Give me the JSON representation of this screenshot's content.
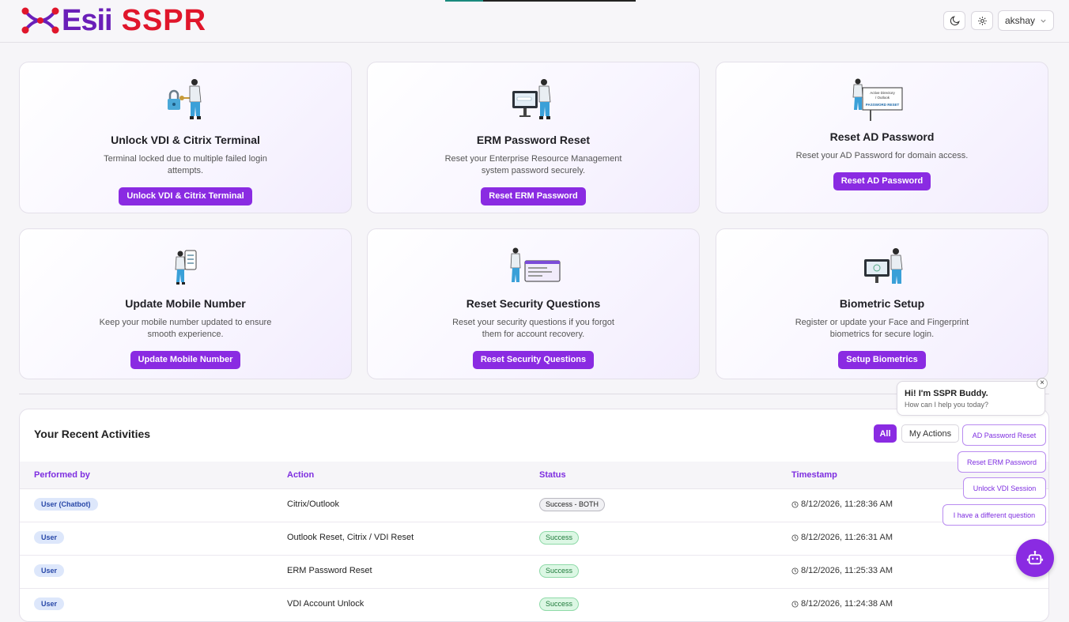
{
  "header": {
    "logo_brand": "Esii",
    "logo_product": "SSPR",
    "theme_icon": "moon-icon",
    "settings_icon": "gear-icon",
    "user_name": "akshay",
    "user_chevron_icon": "chevron-down-icon"
  },
  "cards": [
    {
      "title": "Unlock VDI & Citrix Terminal",
      "description": "Terminal locked due to multiple failed login attempts.",
      "button": "Unlock VDI & Citrix Terminal",
      "icon": "unlock-illustration"
    },
    {
      "title": "ERM Password Reset",
      "description": "Reset your Enterprise Resource Management system password securely.",
      "button": "Reset ERM Password",
      "icon": "monitor-illustration"
    },
    {
      "title": "Reset AD Password",
      "description": "Reset your AD Password for domain access.",
      "button": "Reset AD Password",
      "icon": "billboard-illustration"
    },
    {
      "title": "Update Mobile Number",
      "description": "Keep your mobile number updated to ensure smooth experience.",
      "button": "Update Mobile Number",
      "icon": "phone-illustration"
    },
    {
      "title": "Reset Security Questions",
      "description": "Reset your security questions if you forgot them for account recovery.",
      "button": "Reset Security Questions",
      "icon": "screen-illustration"
    },
    {
      "title": "Biometric Setup",
      "description": "Register or update your Face and Fingerprint biometrics for secure login.",
      "button": "Setup Biometrics",
      "icon": "biometric-illustration"
    }
  ],
  "billboard_text": {
    "line1": "Active Directory",
    "line2": "/ Outlook",
    "line3": "PASSWORD RESET"
  },
  "activities": {
    "title": "Your Recent Activities",
    "filters": {
      "all": "All",
      "mine": "My Actions"
    },
    "columns": [
      "Performed by",
      "Action",
      "Status",
      "Timestamp"
    ],
    "rows": [
      {
        "performed_by": "User (Chatbot)",
        "action": "Citrix/Outlook",
        "status": "Success - BOTH",
        "status_kind": "both",
        "timestamp": "8/12/2026, 11:28:36 AM"
      },
      {
        "performed_by": "User",
        "action": "Outlook Reset, Citrix / VDI Reset",
        "status": "Success",
        "status_kind": "success",
        "timestamp": "8/12/2026, 11:26:31 AM"
      },
      {
        "performed_by": "User",
        "action": "ERM Password Reset",
        "status": "Success",
        "status_kind": "success",
        "timestamp": "8/12/2026, 11:25:33 AM"
      },
      {
        "performed_by": "User",
        "action": "VDI Account Unlock",
        "status": "Success",
        "status_kind": "success",
        "timestamp": "8/12/2026, 11:24:38 AM"
      }
    ]
  },
  "chatbot": {
    "greeting": "Hi! I'm SSPR Buddy.",
    "prompt": "How can I help you today?",
    "close_glyph": "×",
    "quick_replies": [
      "AD Password Reset",
      "Reset ERM Password",
      "Unlock VDI Session",
      "I have a different question"
    ],
    "fab_icon": "robot-icon"
  },
  "colors": {
    "accent": "#8a2be2",
    "logo_purple": "#6a1fb8",
    "logo_red": "#e0162b",
    "success_bg": "#dcf7e4",
    "user_badge_bg": "#dde7fb"
  }
}
